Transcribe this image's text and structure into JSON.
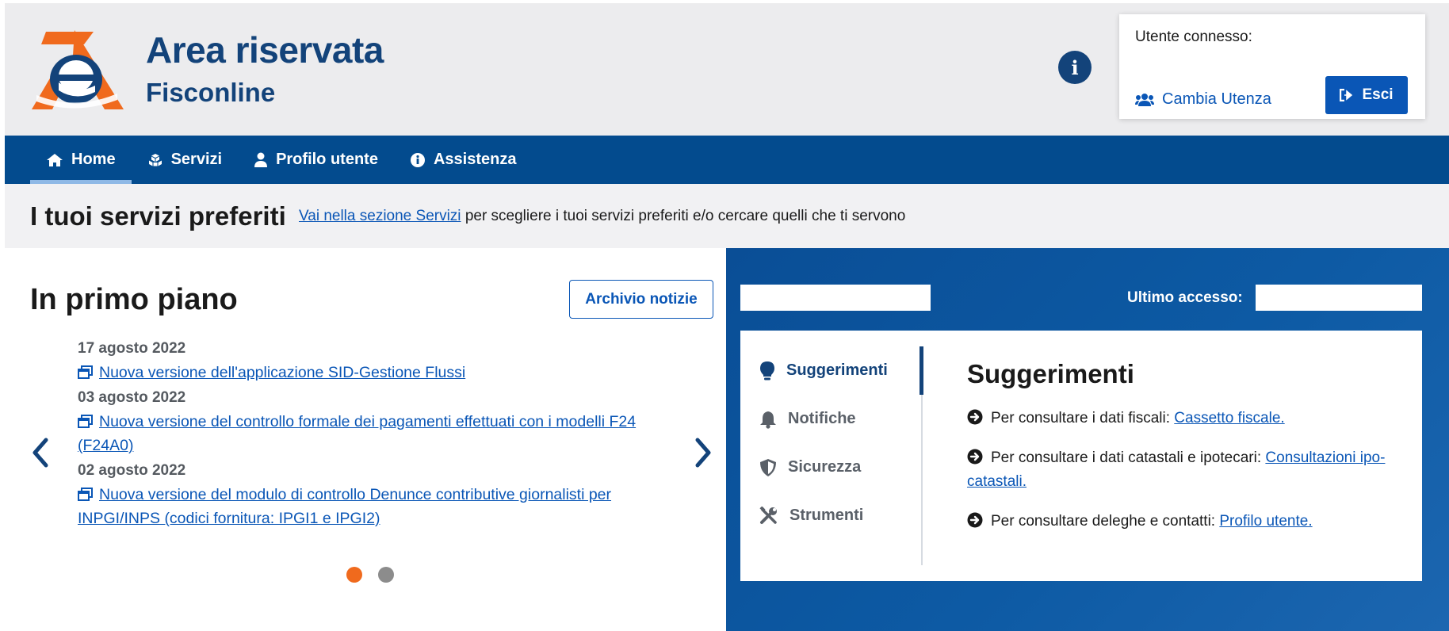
{
  "header": {
    "title": "Area riservata",
    "subtitle": "Fisconline",
    "user_label": "Utente connesso:",
    "switch_user": "Cambia Utenza",
    "logout": "Esci"
  },
  "nav": {
    "items": [
      {
        "label": "Home",
        "icon": "home-icon",
        "active": true
      },
      {
        "label": "Servizi",
        "icon": "services-icon"
      },
      {
        "label": "Profilo utente",
        "icon": "user-icon"
      },
      {
        "label": "Assistenza",
        "icon": "info-icon"
      }
    ]
  },
  "favorites": {
    "title": "I tuoi servizi preferiti",
    "link": "Vai nella sezione Servizi",
    "text": "per scegliere i tuoi servizi preferiti e/o cercare quelli che ti servono"
  },
  "news": {
    "title": "In primo piano",
    "archive_button": "Archivio notizie",
    "items": [
      {
        "date": "17 agosto 2022",
        "text": "Nuova versione dell'applicazione SID-Gestione Flussi"
      },
      {
        "date": "03 agosto 2022",
        "text": "Nuova versione del controllo formale dei pagamenti effettuati con i modelli F24 (F24A0)"
      },
      {
        "date": "02 agosto 2022",
        "text": "Nuova versione del modulo di controllo Denunce contributive giornalisti per INPGI/INPS (codici fornitura: IPGI1 e IPGI2)"
      }
    ],
    "dots": {
      "active_index": 0,
      "count": 2
    }
  },
  "panel": {
    "last_access_label": "Ultimo accesso:",
    "tabs": [
      {
        "label": "Suggerimenti",
        "icon": "lightbulb-icon",
        "active": true
      },
      {
        "label": "Notifiche",
        "icon": "bell-icon"
      },
      {
        "label": "Sicurezza",
        "icon": "shield-icon"
      },
      {
        "label": "Strumenti",
        "icon": "tools-icon"
      }
    ],
    "content_title": "Suggerimenti",
    "tips": [
      {
        "text": "Per consultare i dati fiscali:",
        "link": "Cassetto fiscale."
      },
      {
        "text": "Per consultare i dati catastali e ipotecari:",
        "link": "Consultazioni ipo-catastali."
      },
      {
        "text": "Per consultare deleghe e contatti:",
        "link": "Profilo utente."
      }
    ]
  },
  "colors": {
    "brand_blue": "#13437a",
    "nav_blue": "#034b8e",
    "link_blue": "#0a56b6",
    "accent_orange": "#f06a1d"
  }
}
